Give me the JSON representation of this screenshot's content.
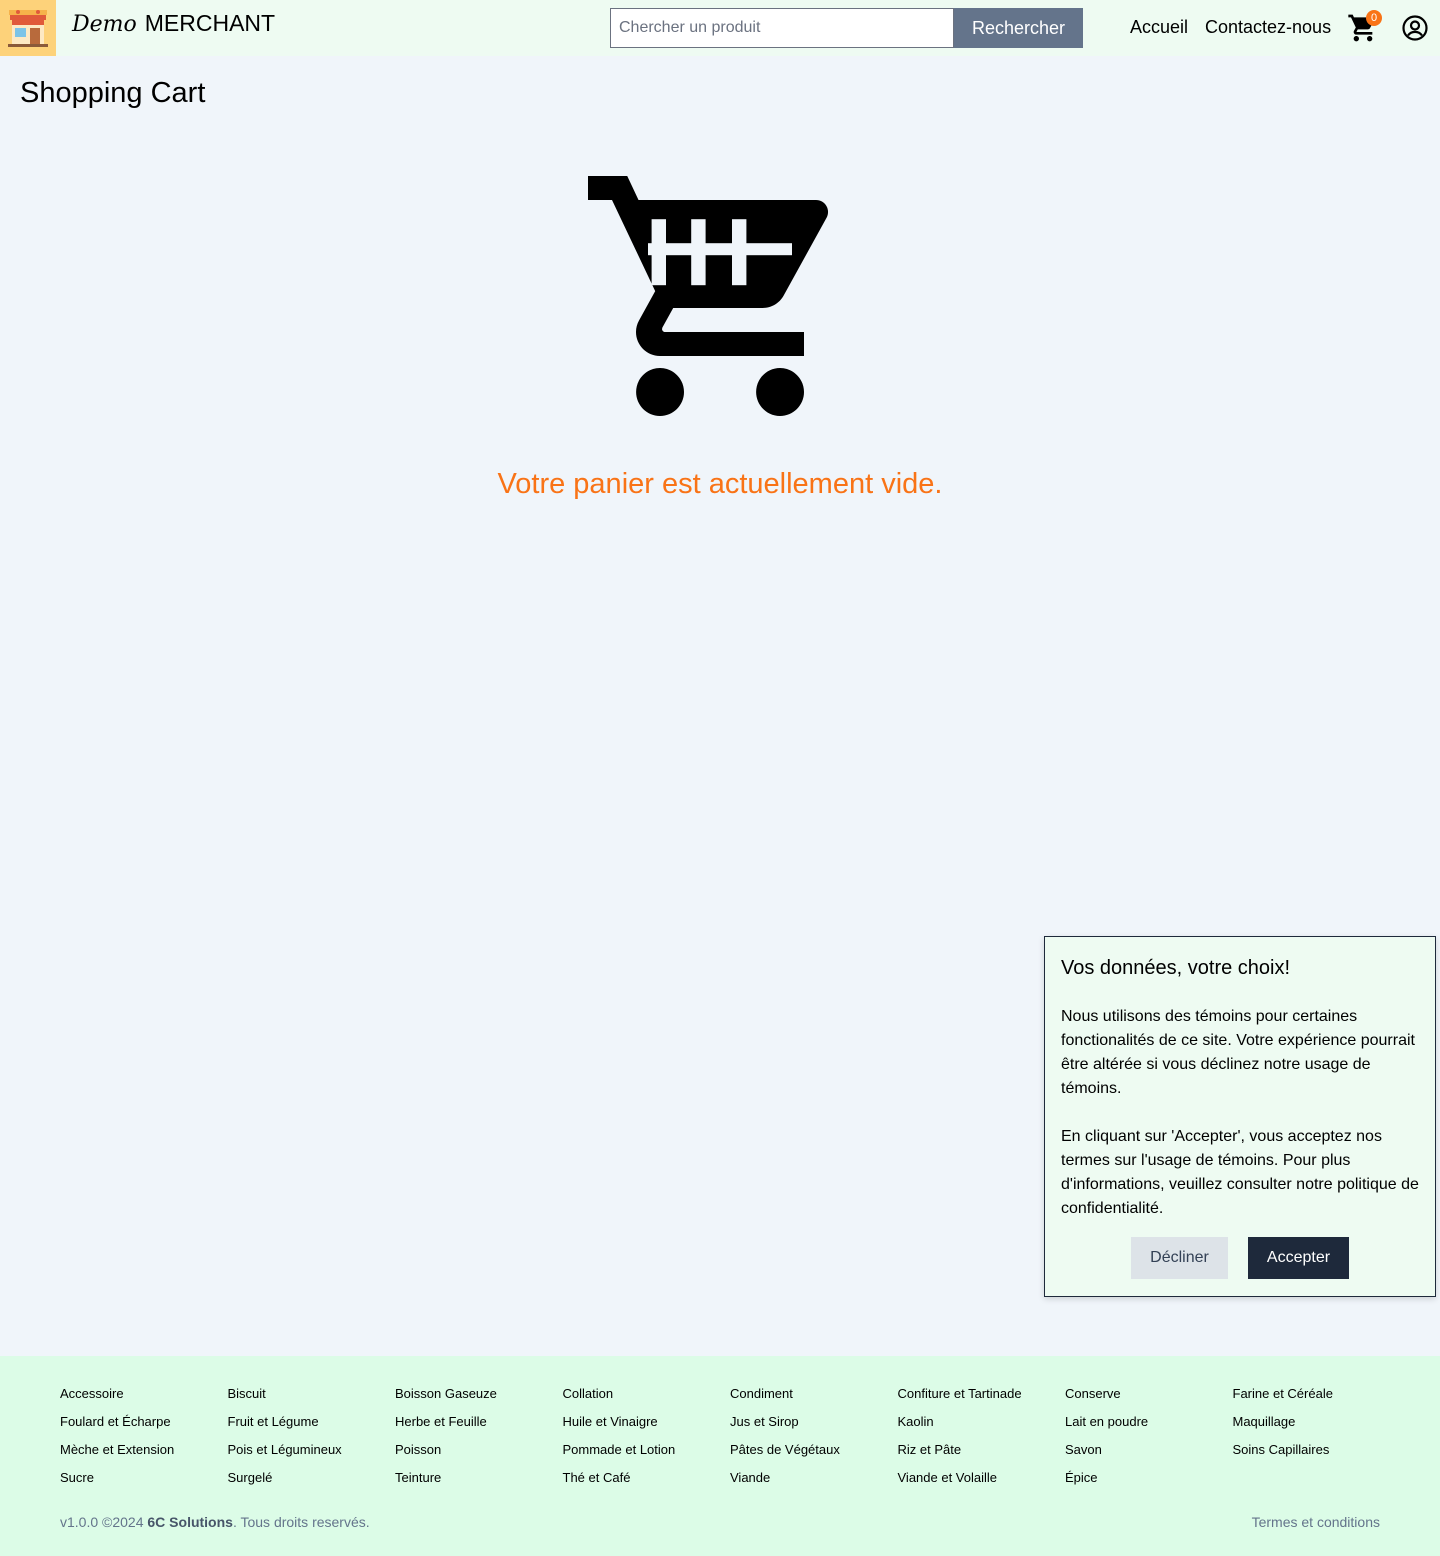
{
  "header": {
    "brand_script": "Demo",
    "brand_name": "MERCHANT",
    "logo_icon": "storefront-icon",
    "search": {
      "placeholder": "Chercher un produit",
      "button_label": "Rechercher"
    },
    "nav": {
      "home_label": "Accueil",
      "contact_label": "Contactez-nous"
    },
    "cart": {
      "icon": "shopping-cart-icon",
      "count": "0"
    },
    "account_icon": "user-circle-icon"
  },
  "main": {
    "title": "Shopping Cart",
    "empty_icon": "shopping-cart-icon",
    "empty_message": "Votre panier est actuellement vide."
  },
  "cookie_banner": {
    "title": "Vos données, votre choix!",
    "paragraph1": "Nous utilisons des témoins pour certaines fonctionalités de ce site. Votre expérience pourrait être altérée si vous déclinez notre usage de témoins.",
    "paragraph2": "En cliquant sur 'Accepter', vous acceptez nos termes sur l'usage de témoins. Pour plus d'informations, veuillez consulter notre politique de confidentialité.",
    "decline_label": "Décliner",
    "accept_label": "Accepter"
  },
  "footer": {
    "categories": [
      "Accessoire",
      "Biscuit",
      "Boisson Gaseuze",
      "Collation",
      "Condiment",
      "Confiture et Tartinade",
      "Conserve",
      "Farine et Céréale",
      "Foulard et Écharpe",
      "Fruit et Légume",
      "Herbe et Feuille",
      "Huile et Vinaigre",
      "Jus et Sirop",
      "Kaolin",
      "Lait en poudre",
      "Maquillage",
      "Mèche et Extension",
      "Pois et Légumineux",
      "Poisson",
      "Pommade et Lotion",
      "Pâtes de Végétaux",
      "Riz et Pâte",
      "Savon",
      "Soins Capillaires",
      "Sucre",
      "Surgelé",
      "Teinture",
      "Thé et Café",
      "Viande",
      "Viande et Volaille",
      "Épice"
    ],
    "copyright_prefix": "v1.0.0 ©2024",
    "company": "6C Solutions",
    "copyright_suffix": ". Tous droits reservés.",
    "terms_label": "Termes et conditions"
  },
  "colors": {
    "header_bg": "#eefbf2",
    "page_bg": "#f0f5fa",
    "footer_bg": "#dcfce7",
    "accent_orange": "#f97316",
    "search_button": "#64748b",
    "accept_button": "#1e293b"
  }
}
